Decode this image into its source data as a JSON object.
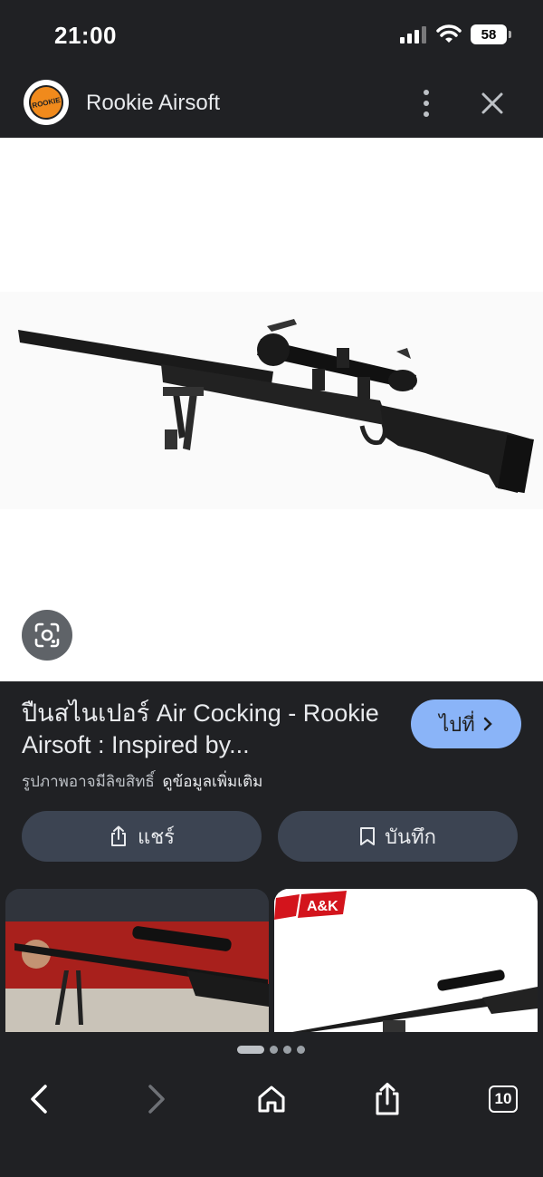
{
  "status_bar": {
    "time": "21:00",
    "battery": "58"
  },
  "header": {
    "site_name": "Rookie Airsoft",
    "logo_text": "ROOKIE"
  },
  "result": {
    "title": "ปืนสไนเปอร์ Air Cocking - Rookie Airsoft : Inspired by...",
    "go_label": "ไปที่",
    "copyright_text": "รูปภาพอาจมีลิขสิทธิ์",
    "more_info_link": "ดูข้อมูลเพิ่มเติม"
  },
  "actions": {
    "share_label": "แชร์",
    "save_label": "บันทึก"
  },
  "related": {
    "thumb2_brand": "A&K"
  },
  "bottom_nav": {
    "tabs_count": "10"
  },
  "icons": [
    "signal-icon",
    "wifi-icon",
    "battery-icon",
    "more-vert-icon",
    "close-icon",
    "lens-icon",
    "chevron-right-icon",
    "share-icon",
    "bookmark-icon",
    "back-icon",
    "forward-icon",
    "home-icon",
    "tabs-icon"
  ]
}
